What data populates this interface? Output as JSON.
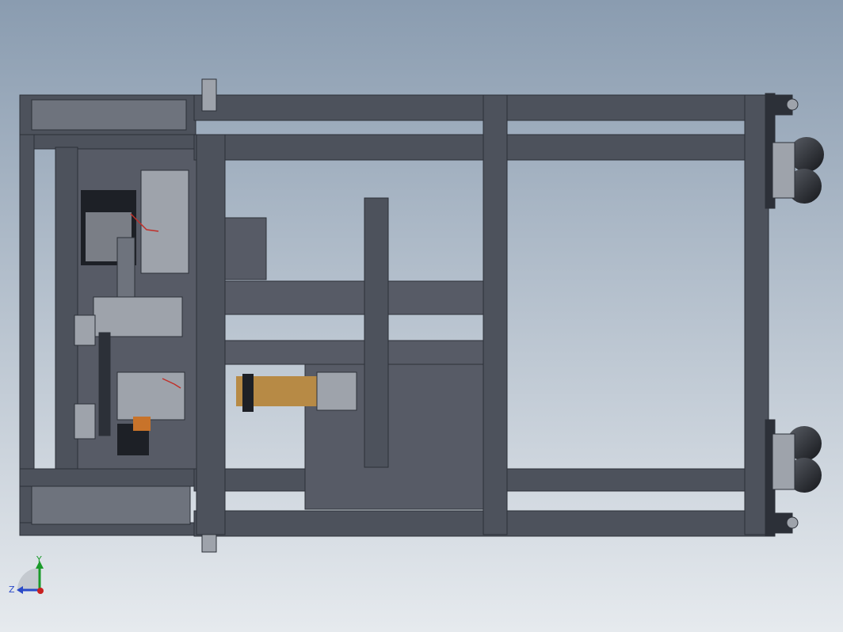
{
  "viewport": {
    "background_top": "#8a9cb0",
    "background_bottom": "#e6eaee"
  },
  "colors": {
    "frame": "#4d525c",
    "frame_dark": "#2c3038",
    "frame_light": "#6e737d",
    "panel": "#575b66",
    "part_light": "#9ea3ab",
    "part_black": "#1d2026",
    "brass": "#b78a45",
    "orange": "#c8732a",
    "wire_red": "#c0302a",
    "axis_y": "#1a9a2a",
    "axis_z": "#2a4ac8",
    "axis_x": "#c82020"
  },
  "triad": {
    "y_label": "Y",
    "z_label": "Z",
    "icon": "coordinate-triad-icon"
  }
}
